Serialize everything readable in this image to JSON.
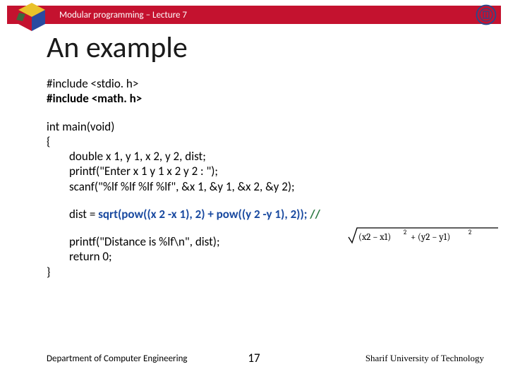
{
  "header": {
    "lecture": "Modular programming – Lecture 7"
  },
  "title": "An example",
  "code": {
    "inc1": "#include <stdio. h>",
    "inc2": "#include <math. h>",
    "main_sig": "int main(void)",
    "brace_open": "{",
    "decl": "double x 1, y 1, x 2, y 2, dist;",
    "printf1": "printf(\"Enter x 1 y 1 x 2 y 2 : \");",
    "scanf": "scanf(\"%lf %lf %lf %lf\", &x 1, &y 1, &x 2, &y 2);",
    "dist_pre": "dist = ",
    "dist_expr": "sqrt(pow((x 2 -x 1), 2)  + pow((y 2 -y 1), 2));",
    "comment": "  //",
    "printf2": "printf(\"Distance is %lf\\n\", dist);",
    "ret": "return 0;",
    "brace_close": "}"
  },
  "footer": {
    "left": "Department of Computer Engineering",
    "page": "17",
    "right": "Sharif University of Technology"
  }
}
